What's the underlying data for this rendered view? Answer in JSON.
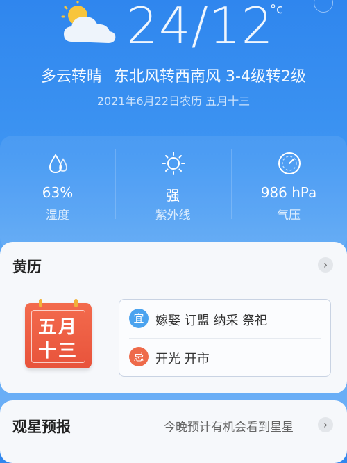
{
  "weather": {
    "temp_range": "24/12",
    "temp_unit": "°c",
    "condition": "多云转晴",
    "wind": "东北风转西南风 3-4级转2级",
    "date": "2021年6月22日农历 五月十三",
    "icon": "partly-cloudy-icon"
  },
  "stats": [
    {
      "value": "63%",
      "label": "湿度",
      "icon": "droplets-icon"
    },
    {
      "value": "强",
      "label": "紫外线",
      "icon": "sun-icon"
    },
    {
      "value": "986 hPa",
      "label": "气压",
      "icon": "gauge-icon"
    }
  ],
  "almanac": {
    "title": "黄历",
    "calendar_line1": "五月",
    "calendar_line2": "十三",
    "yi_badge": "宜",
    "yi_text": "嫁娶 订盟 纳采 祭祀",
    "ji_badge": "忌",
    "ji_text": "开光 开市",
    "colors": {
      "yi": "#4ba3ef",
      "ji": "#ee6a4a"
    }
  },
  "stargazing": {
    "title": "观星预报",
    "subtitle": "今晚预计有机会看到星星"
  }
}
